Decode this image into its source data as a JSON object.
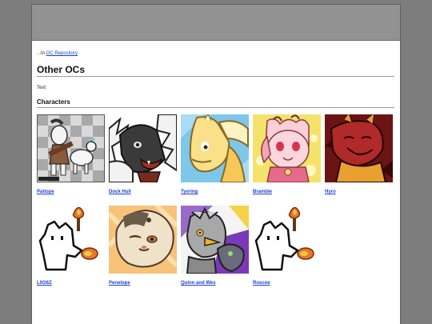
{
  "breadcrumb": {
    "prefix": "...In ",
    "link": "OC Repository"
  },
  "page_title": "Other OCs",
  "intro_text": "Text",
  "section_title": "Characters",
  "characters": [
    {
      "name": "Patiope",
      "icon": "goat-character-icon"
    },
    {
      "name": "Dock Hull",
      "icon": "gray-beast-character-icon"
    },
    {
      "name": "Tyvring",
      "icon": "yellow-dragon-character-icon"
    },
    {
      "name": "Bramble",
      "icon": "pink-creature-character-icon"
    },
    {
      "name": "Hyro",
      "icon": "red-dragon-character-icon"
    },
    {
      "name": "L0G6Z",
      "icon": "white-blob-torch-icon"
    },
    {
      "name": "Penelope",
      "icon": "tan-cat-character-icon"
    },
    {
      "name": "Quinn and Wes",
      "icon": "gray-bird-pair-character-icon"
    },
    {
      "name": "Roscoe",
      "icon": "white-blob-torch-icon"
    }
  ]
}
